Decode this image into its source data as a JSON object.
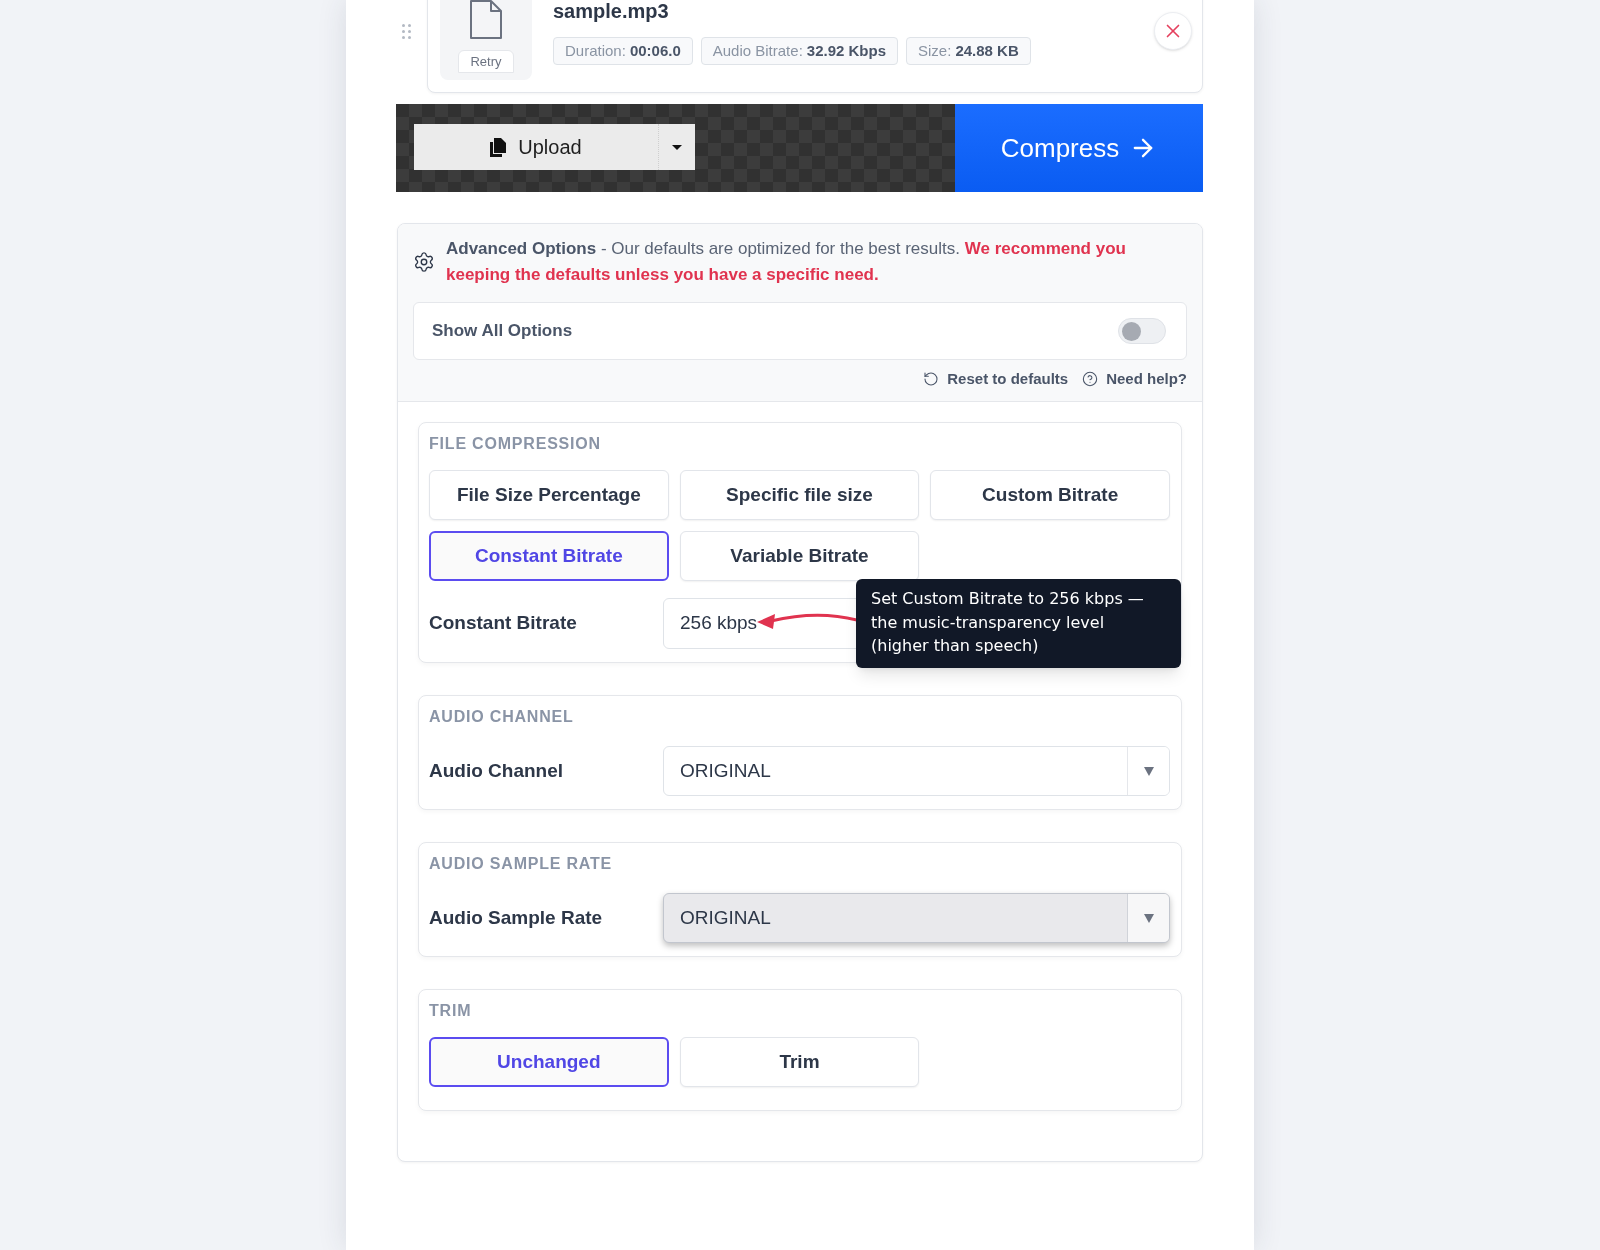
{
  "file": {
    "name": "sample.mp3",
    "retry": "Retry",
    "meta": [
      {
        "label": "Duration:",
        "value": "00:06.0"
      },
      {
        "label": "Audio Bitrate:",
        "value": "32.92 Kbps"
      },
      {
        "label": "Size:",
        "value": "24.88 KB"
      }
    ]
  },
  "upload_bar": {
    "upload": "Upload",
    "compress": "Compress"
  },
  "advanced": {
    "title": "Advanced Options",
    "text": "- Our defaults are optimized for the best results.",
    "warning": "We recommend you keeping the defaults unless you have a specific need.",
    "show_all": {
      "label": "Show All Options",
      "on": false
    },
    "links": [
      {
        "kind": "reset",
        "label": "Reset to defaults"
      },
      {
        "kind": "help",
        "label": "Need help?"
      }
    ]
  },
  "sections": [
    {
      "kind": "options",
      "title": "FILE COMPRESSION",
      "options": [
        {
          "label": "File Size Percentage",
          "selected": false
        },
        {
          "label": "Specific file size",
          "selected": false
        },
        {
          "label": "Custom Bitrate",
          "selected": false
        },
        {
          "label": "Constant Bitrate",
          "selected": true
        },
        {
          "label": "Variable Bitrate",
          "selected": false
        }
      ],
      "field": {
        "label": "Constant Bitrate",
        "value": "256 kbps",
        "tooltip": "Set Custom Bitrate to 256 kbps — the music-transparency level (higher than speech)"
      }
    },
    {
      "kind": "select",
      "title": "AUDIO CHANNEL",
      "label": "Audio Channel",
      "value": "ORIGINAL",
      "focused": false
    },
    {
      "kind": "select",
      "title": "AUDIO SAMPLE RATE",
      "label": "Audio Sample Rate",
      "value": "ORIGINAL",
      "focused": true
    },
    {
      "kind": "options",
      "title": "TRIM",
      "options": [
        {
          "label": "Unchanged",
          "selected": true
        },
        {
          "label": "Trim",
          "selected": false
        }
      ]
    }
  ]
}
